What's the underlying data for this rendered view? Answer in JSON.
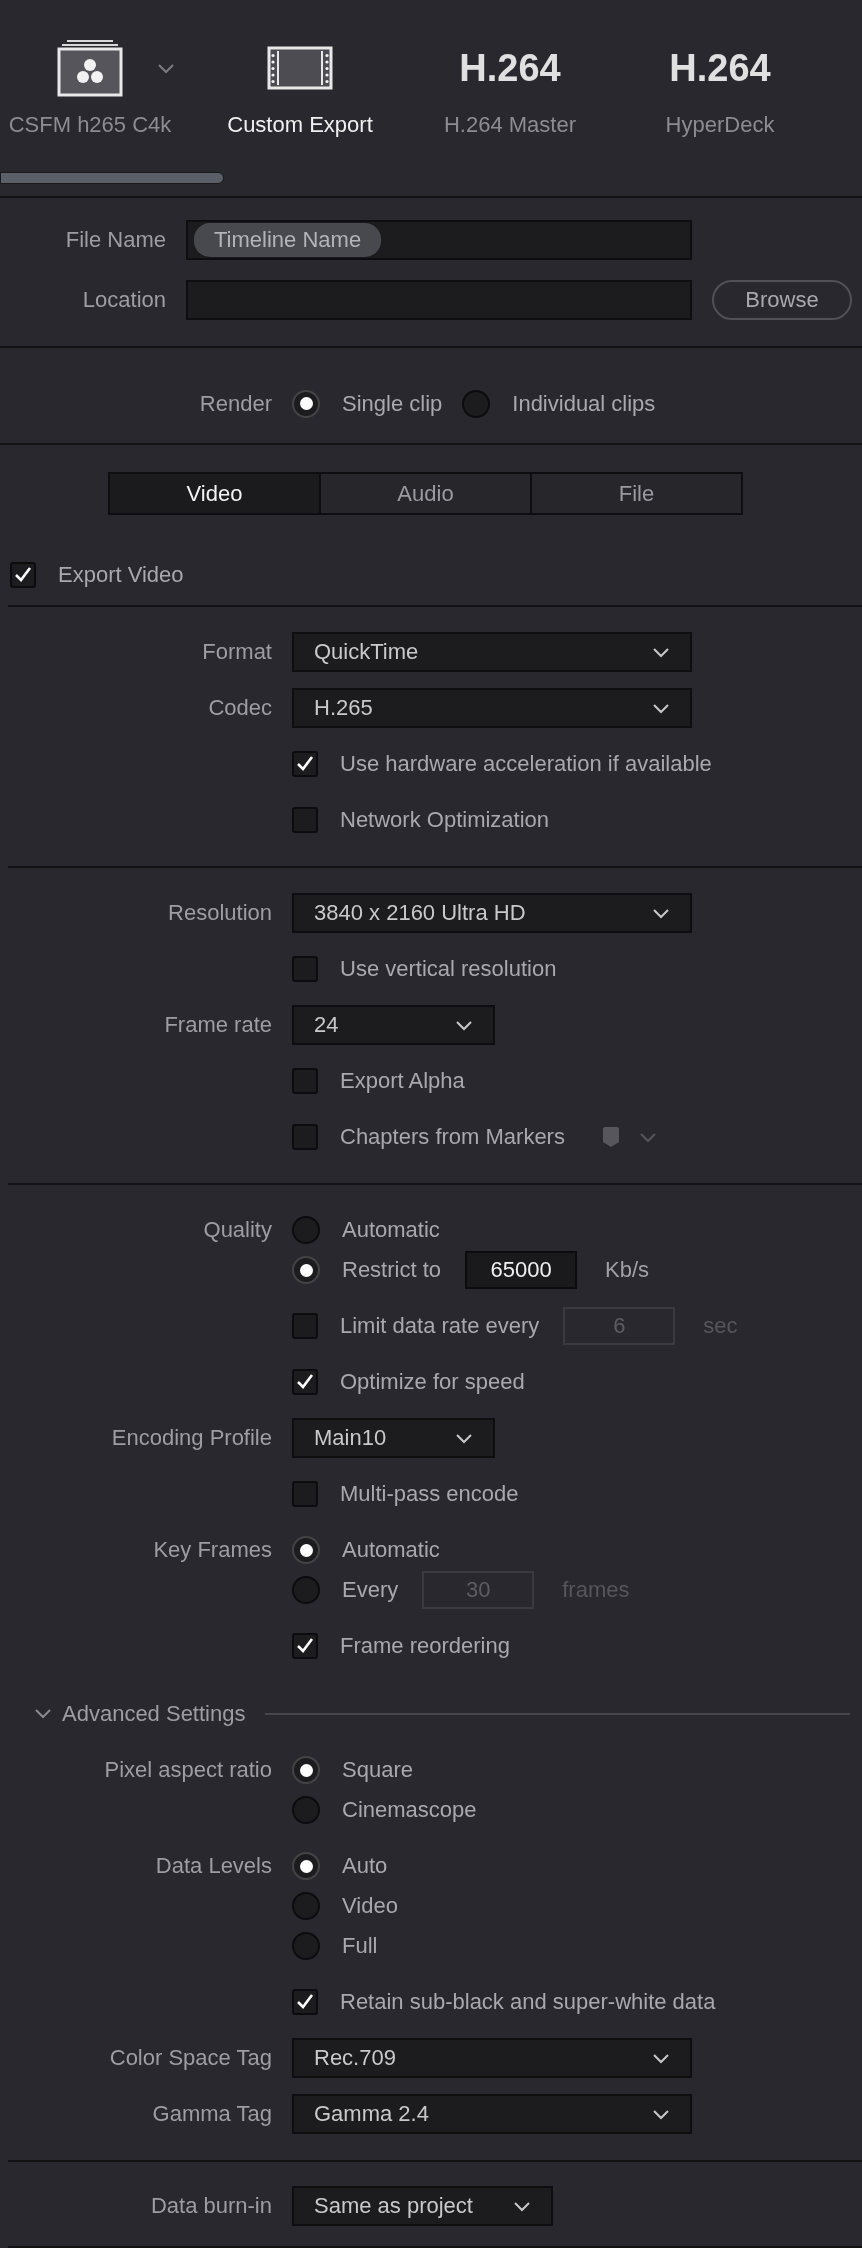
{
  "presets": [
    {
      "kind": "logo",
      "label": "CSFM h265 C4k",
      "selected": false,
      "has_menu": true
    },
    {
      "kind": "film",
      "label": "Custom Export",
      "selected": true,
      "has_menu": false
    },
    {
      "kind": "text",
      "icon_text": "H.264",
      "label": "H.264 Master",
      "selected": false,
      "has_menu": false
    },
    {
      "kind": "text",
      "icon_text": "H.264",
      "label": "HyperDeck",
      "selected": false,
      "has_menu": false
    }
  ],
  "file_name": {
    "label": "File Name",
    "token": "Timeline Name"
  },
  "location": {
    "label": "Location",
    "browse": "Browse"
  },
  "render": {
    "label": "Render",
    "options": [
      {
        "label": "Single clip",
        "selected": true
      },
      {
        "label": "Individual clips",
        "selected": false
      }
    ]
  },
  "tabs": [
    {
      "label": "Video",
      "selected": true
    },
    {
      "label": "Audio",
      "selected": false
    },
    {
      "label": "File",
      "selected": false
    }
  ],
  "export_video": {
    "label": "Export Video",
    "checked": true
  },
  "sections": [
    {
      "rows": [
        {
          "kind": "dropdown",
          "label": "Format",
          "value": "QuickTime"
        },
        {
          "kind": "dropdown",
          "label": "Codec",
          "value": "H.265"
        },
        {
          "kind": "checkbox",
          "text": "Use hardware acceleration if available",
          "checked": true
        },
        {
          "kind": "checkbox",
          "text": "Network Optimization",
          "checked": false
        }
      ]
    },
    {
      "rows": [
        {
          "kind": "dropdown",
          "label": "Resolution",
          "value": "3840 x 2160 Ultra HD"
        },
        {
          "kind": "checkbox",
          "text": "Use vertical resolution",
          "checked": false
        },
        {
          "kind": "compact_dropdown",
          "label": "Frame rate",
          "value": "24"
        },
        {
          "kind": "checkbox",
          "text": "Export Alpha",
          "checked": false
        },
        {
          "kind": "checkbox",
          "text": "Chapters from Markers",
          "checked": false,
          "marker_menu": true
        }
      ]
    },
    {
      "rows": [
        {
          "kind": "radio",
          "label": "Quality",
          "text": "Automatic",
          "selected": false
        },
        {
          "kind": "radio",
          "text": "Restrict to",
          "selected": true,
          "input": "65000",
          "unit": "Kb/s",
          "input_disabled": false
        },
        {
          "kind": "checkbox",
          "text": "Limit data rate every",
          "checked": false,
          "input": "6",
          "unit": "sec",
          "input_disabled": true
        },
        {
          "kind": "checkbox",
          "text": "Optimize for speed",
          "checked": true
        },
        {
          "kind": "compact_dropdown",
          "label": "Encoding Profile",
          "value": "Main10"
        },
        {
          "kind": "checkbox",
          "text": "Multi-pass encode",
          "checked": false
        },
        {
          "kind": "radio",
          "label": "Key Frames",
          "text": "Automatic",
          "selected": true
        },
        {
          "kind": "radio",
          "text": "Every",
          "selected": false,
          "input": "30",
          "unit": "frames",
          "input_disabled": true
        },
        {
          "kind": "checkbox",
          "text": "Frame reordering",
          "checked": true
        },
        {
          "kind": "header",
          "text": "Advanced Settings",
          "expanded": true
        },
        {
          "kind": "radio",
          "label": "Pixel aspect ratio",
          "text": "Square",
          "selected": true
        },
        {
          "kind": "radio",
          "text": "Cinemascope",
          "selected": false
        },
        {
          "kind": "radio",
          "label": "Data Levels",
          "text": "Auto",
          "selected": true
        },
        {
          "kind": "radio",
          "text": "Video",
          "selected": false
        },
        {
          "kind": "radio",
          "text": "Full",
          "selected": false
        },
        {
          "kind": "checkbox",
          "text": "Retain sub-black and super-white data",
          "checked": true
        },
        {
          "kind": "dropdown",
          "label": "Color Space Tag",
          "value": "Rec.709"
        },
        {
          "kind": "dropdown",
          "label": "Gamma Tag",
          "value": "Gamma 2.4"
        }
      ]
    },
    {
      "rows": [
        {
          "kind": "compact_dropdown",
          "label": "Data burn-in",
          "value": "Same as project"
        }
      ]
    }
  ]
}
